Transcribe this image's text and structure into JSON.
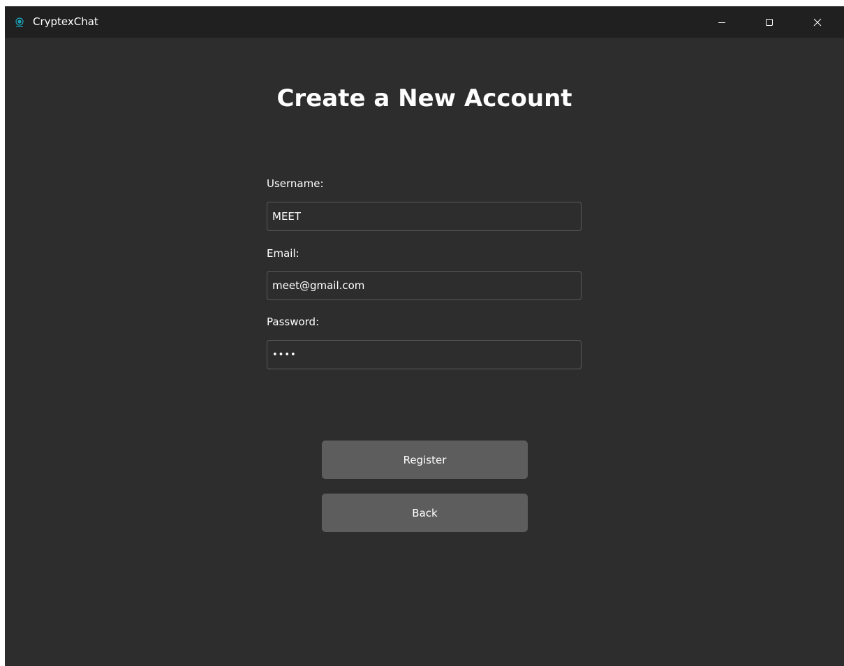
{
  "window": {
    "title": "CryptexChat",
    "icon": "cryptexchat-logo-icon",
    "controls": [
      "minimize-icon",
      "maximize-icon",
      "close-icon"
    ]
  },
  "page": {
    "title": "Create a New Account"
  },
  "form": {
    "username_label": "Username:",
    "username_value": "MEET",
    "email_label": "Email:",
    "email_value": "meet@gmail.com",
    "password_label": "Password:",
    "password_value": "••••"
  },
  "actions": {
    "register_label": "Register",
    "back_label": "Back"
  },
  "colors": {
    "background": "#2d2d2d",
    "titlebar": "#202020",
    "button": "#5d5d5d",
    "accent": "#1aa3b8"
  }
}
